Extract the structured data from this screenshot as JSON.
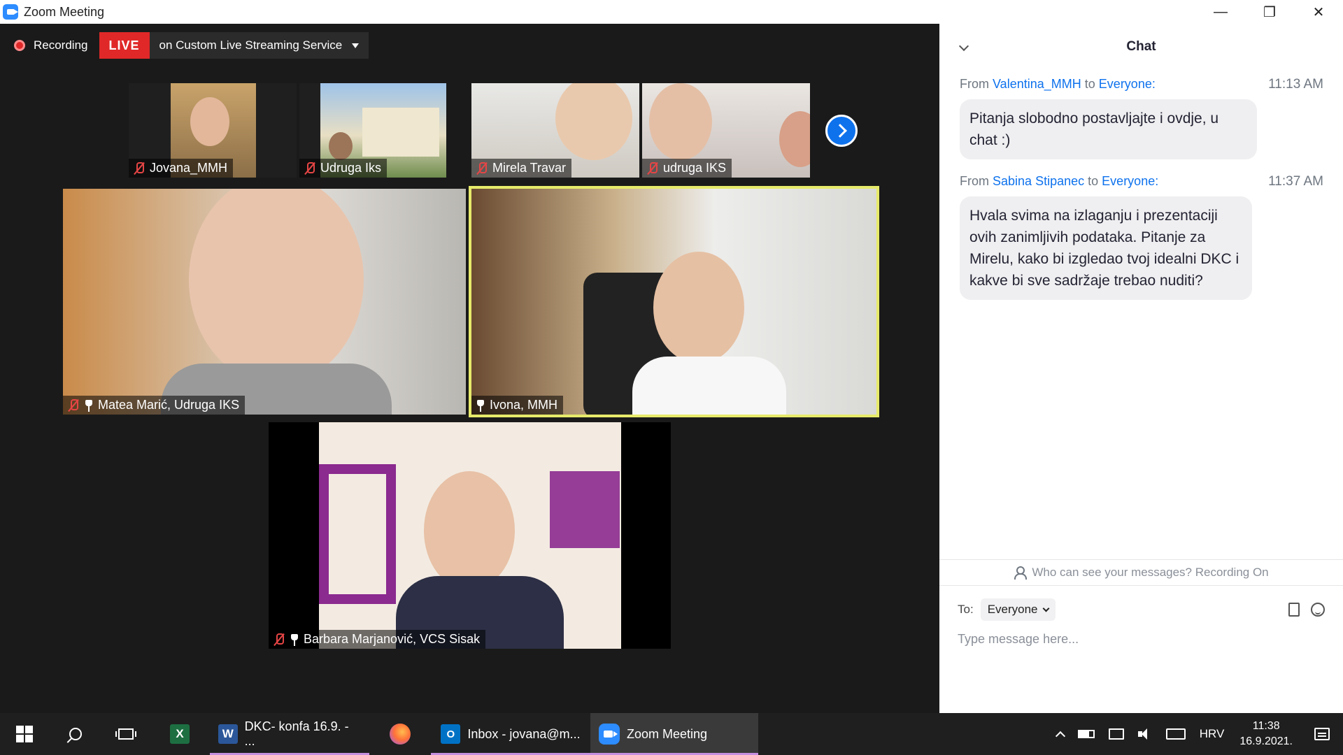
{
  "window": {
    "title": "Zoom Meeting",
    "minimize": "—",
    "restore": "❐",
    "close": "✕"
  },
  "recording": {
    "label": "Recording",
    "live_badge": "LIVE",
    "stream_target": "on Custom Live Streaming Service"
  },
  "participants_strip": [
    {
      "name": "Jovana_MMH"
    },
    {
      "name": "Udruga Iks"
    },
    {
      "name": "Mirela Travar"
    },
    {
      "name": "udruga IKS"
    }
  ],
  "main_tiles": [
    {
      "name": "Matea Marić, Udruga IKS"
    },
    {
      "name": "Ivona, MMH"
    },
    {
      "name": "Barbara Marjanović, VCS Sisak"
    }
  ],
  "chat": {
    "title": "Chat",
    "messages": [
      {
        "from_label": "From",
        "sender": "Valentina_MMH",
        "to_label": "to",
        "recipient": "Everyone:",
        "time": "11:13 AM",
        "text": "Pitanja slobodno postavljajte i ovdje, u chat :)"
      },
      {
        "from_label": "From",
        "sender": "Sabina Stipanec",
        "to_label": "to",
        "recipient": "Everyone:",
        "time": "11:37 AM",
        "text": "Hvala svima na izlaganju i prezentaciji ovih zanimljivih podataka. Pitanje za Mirelu, kako bi izgledao tvoj idealni DKC i kakve bi sve sadržaje trebao nuditi?"
      }
    ],
    "visibility_note": "Who can see your messages? Recording On",
    "to_label": "To:",
    "to_value": "Everyone",
    "input_placeholder": "Type message here..."
  },
  "taskbar": {
    "apps": [
      {
        "label": "DKC- konfa 16.9. - ..."
      },
      {
        "label": "Inbox - jovana@m..."
      },
      {
        "label": "Zoom Meeting"
      }
    ],
    "language": "HRV",
    "time": "11:38",
    "date": "16.9.2021."
  },
  "colors": {
    "accent": "#0e72ed",
    "live": "#e02828",
    "active_speaker_border": "#e6ea6a",
    "muted_icon": "#e64545"
  }
}
